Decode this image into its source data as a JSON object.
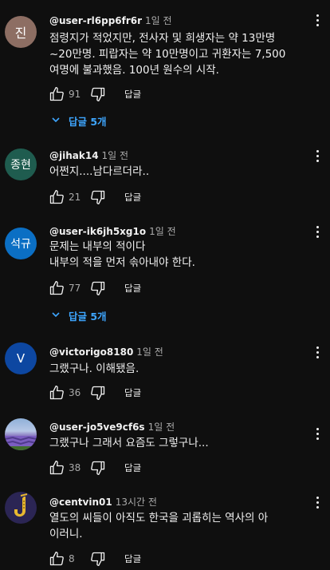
{
  "colors": {
    "background": "#0f0f0f",
    "link": "#3ea6ff",
    "muted": "#aaaaaa"
  },
  "icons": {
    "like": "thumb-up-icon",
    "dislike": "thumb-down-icon",
    "menu": "more-vert-icon",
    "expand": "chevron-down-icon"
  },
  "comments": [
    {
      "avatar_text": "진",
      "avatar_color": "#8d6e63",
      "author": "@user-rl6pp6fr6r",
      "time": "1일 전",
      "lines": [
        "점령지가 적었지만, 전사자 및 희생자는 약 13만명",
        "~20만명. 피랍자는 약 10만명이고 귀환자는 7,500",
        "여명에 불과했음. 100년 원수의 시작."
      ],
      "likes": "91",
      "reply_label": "답글",
      "replies": "답글 5개"
    },
    {
      "avatar_text": "종현",
      "avatar_color": "#1f5c4f",
      "author": "@jihak14",
      "time": "1일 전",
      "lines": [
        "어쩐지....남다르더라.."
      ],
      "likes": "21",
      "reply_label": "답글"
    },
    {
      "avatar_text": "석규",
      "avatar_color": "#0b6fc4",
      "author": "@user-ik6jh5xg1o",
      "time": "1일 전",
      "lines": [
        "문제는 내부의 적이다",
        "내부의 적을 먼저 솎아내야 한다."
      ],
      "likes": "77",
      "reply_label": "답글",
      "replies": "답글 5개"
    },
    {
      "avatar_text": "V",
      "avatar_color": "#0d47a1",
      "author": "@victorigo8180",
      "time": "1일 전",
      "lines": [
        "그랬구나. 이해됐음."
      ],
      "likes": "36",
      "reply_label": "답글"
    },
    {
      "avatar_text": "",
      "avatar_color": "#6a5acd",
      "author": "@user-jo5ve9cf6s",
      "time": "1일 전",
      "lines": [
        "그랬구나 그래서  요즘도  그렇구나..."
      ],
      "likes": "38",
      "reply_label": "답글"
    },
    {
      "avatar_text": "",
      "avatar_color": "#2b2554",
      "author": "@centvin01",
      "time": "13시간 전",
      "lines": [
        "열도의 씨들이 아직도 한국을 괴롭히는 역사의 아",
        "이러니."
      ],
      "likes": "8",
      "reply_label": "답글"
    }
  ]
}
